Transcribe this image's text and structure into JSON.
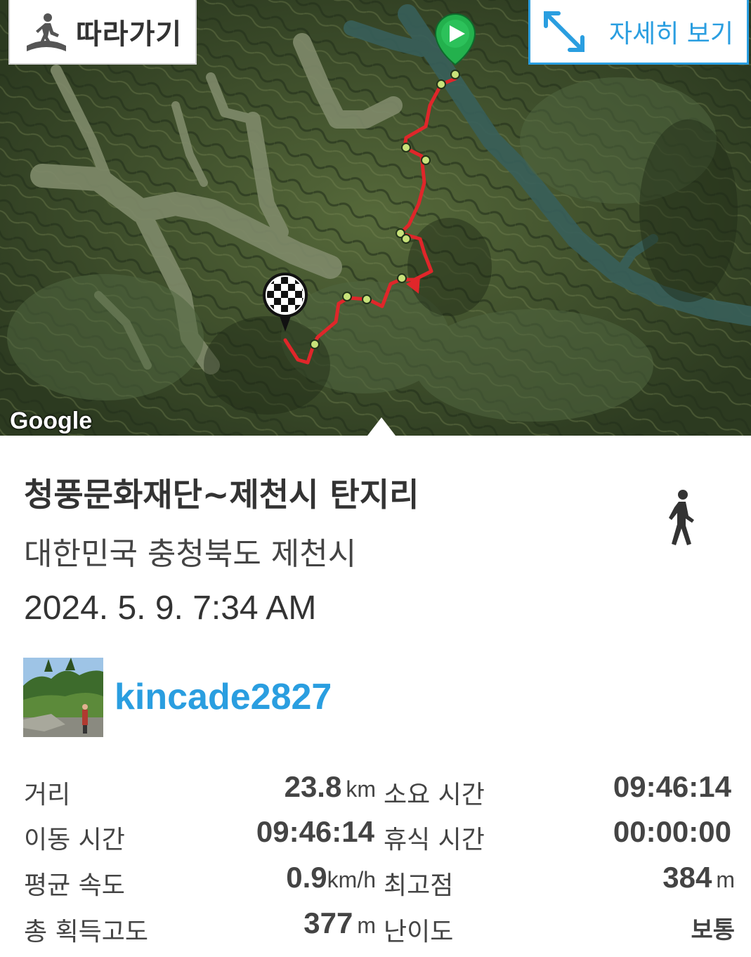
{
  "map": {
    "follow_label": "따라가기",
    "detail_label": "자세히 보기",
    "attribution": "Google",
    "route_color": "#e0262a",
    "start_marker_color": "#23b14d",
    "icons": {
      "follow": "hiker-icon",
      "detail": "expand-arrows-icon",
      "start": "play-pin-icon",
      "finish": "checkered-flag-pin-icon"
    }
  },
  "track": {
    "title": "청풍문화재단~제천시 탄지리",
    "address": "대한민국 충청북도 제천시",
    "datetime": "2024. 5. 9. 7:34 AM",
    "activity_icon": "walking-icon",
    "user": "kincade2827"
  },
  "stats": {
    "distance": {
      "label": "거리",
      "value": "23.8",
      "unit": "km"
    },
    "duration": {
      "label": "소요 시간",
      "value": "09:46:14"
    },
    "moving_time": {
      "label": "이동 시간",
      "value": "09:46:14"
    },
    "rest_time": {
      "label": "휴식 시간",
      "value": "00:00:00"
    },
    "avg_speed": {
      "label": "평균 속도",
      "value": "0.9",
      "unit": "km/h"
    },
    "max_altitude": {
      "label": "최고점",
      "value": "384",
      "unit": "m"
    },
    "total_ascent": {
      "label": "총 획득고도",
      "value": "377",
      "unit": "m"
    },
    "difficulty": {
      "label": "난이도",
      "value": "보통"
    }
  },
  "colors": {
    "accent": "#2a9ee0",
    "text": "#333333"
  }
}
